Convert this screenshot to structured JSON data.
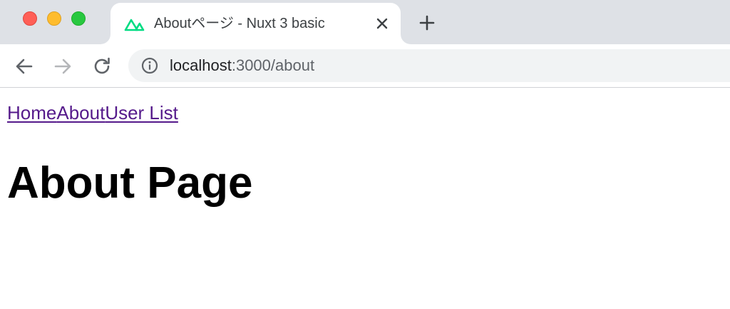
{
  "browser": {
    "tab": {
      "title": "Aboutページ - Nuxt 3 basic",
      "favicon": "nuxt-logo-icon"
    },
    "address_bar": {
      "host": "localhost",
      "path": ":3000/about"
    },
    "icons": {
      "back": "arrow-left-icon",
      "forward": "arrow-right-icon",
      "reload": "reload-icon",
      "info": "info-icon",
      "close_tab": "close-icon",
      "new_tab": "plus-icon"
    }
  },
  "page": {
    "nav": {
      "links": [
        "Home",
        "About",
        "User List"
      ]
    },
    "heading": "About Page"
  },
  "colors": {
    "tabstrip_bg": "#dee1e6",
    "link_visited": "#551a8b",
    "nuxt_green": "#00dc82"
  }
}
